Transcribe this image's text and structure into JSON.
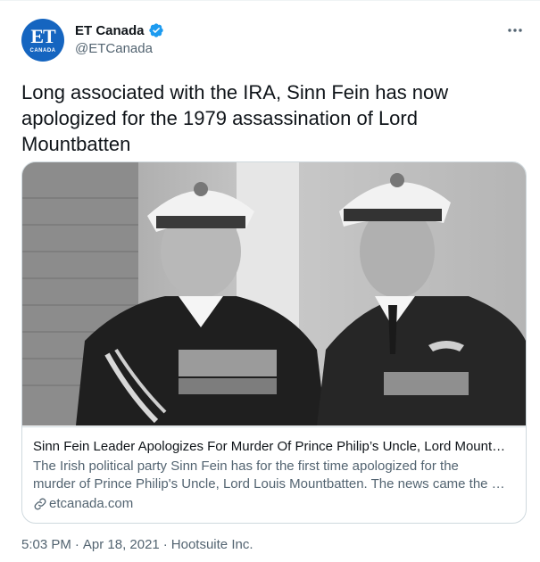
{
  "account": {
    "name": "ET Canada",
    "handle": "@ETCanada",
    "avatar_text": "ET",
    "avatar_subtext": "CANADA",
    "verified_icon": "verified-badge-icon"
  },
  "tweet": {
    "text": "Long associated with the IRA, Sinn Fein has now apologized for the 1979 assassination of Lord Mountbatten",
    "time": "5:03 PM",
    "separator": "·",
    "date": "Apr 18, 2021",
    "source": "Hootsuite Inc."
  },
  "card": {
    "title": "Sinn Fein Leader Apologizes For Murder Of Prince Philip’s Uncle, Lord Mount…",
    "description_line1": "The Irish political party Sinn Fein has for the first time apologized for the",
    "description_line2": "murder of Prince Philip's Uncle, Lord Louis Mountbatten. The news came the …",
    "domain": "etcanada.com"
  },
  "menu": {
    "more_icon": "more-options-icon"
  },
  "colors": {
    "verified_blue": "#1d9bf0",
    "avatar_blue": "#1565c0",
    "secondary_text": "#536471",
    "border": "#cfd9de"
  }
}
